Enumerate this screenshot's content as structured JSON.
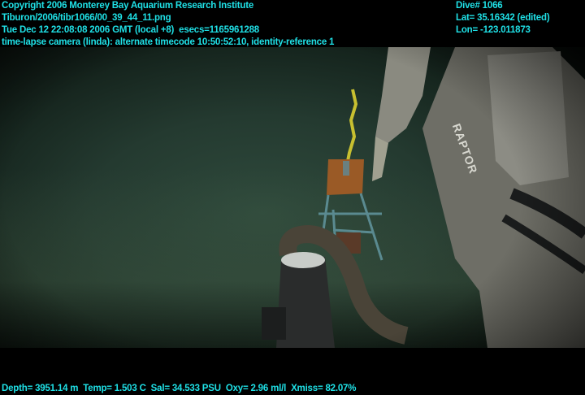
{
  "overlay_top_left": [
    "Copyright 2006 Monterey Bay Aquarium Research Institute",
    "Tiburon/2006/tibr1066/00_39_44_11.png",
    "Tue Dec 12 22:08:08 2006 GMT (local +8)  esecs=1165961288",
    "time-lapse camera (linda): alternate timecode 10:50:52:10, identity-reference 1"
  ],
  "overlay_top_right": [
    "Dive# 1066",
    "Lat= 35.16342 (edited)",
    "Lon= -123.011873"
  ],
  "overlay_bottom": "Depth= 3951.14 m  Temp= 1.503 C  Sal= 34.533 PSU  Oxy= 2.96 ml/l  Xmiss= 82.07%",
  "manipulator_label": "RAPTOR"
}
